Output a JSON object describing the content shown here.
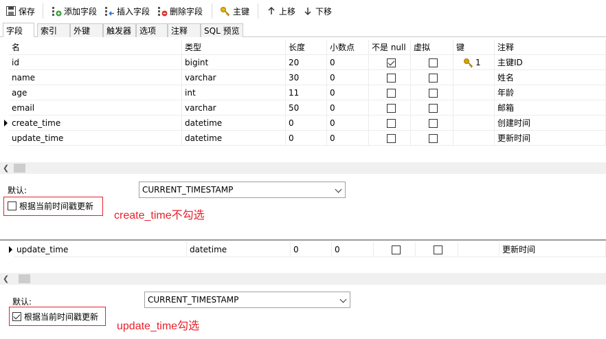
{
  "toolbar": {
    "save": "保存",
    "add_field": "添加字段",
    "insert_field": "插入字段",
    "delete_field": "删除字段",
    "primary_key": "主键",
    "move_up": "上移",
    "move_down": "下移"
  },
  "tabs": [
    "字段",
    "索引",
    "外键",
    "触发器",
    "选项",
    "注释",
    "SQL 预览"
  ],
  "columns": [
    "名",
    "类型",
    "长度",
    "小数点",
    "不是 null",
    "虚拟",
    "键",
    "注释"
  ],
  "rows": [
    {
      "name": "id",
      "type": "bigint",
      "length": "20",
      "decimal": "0",
      "not_null": true,
      "virtual": false,
      "key": "1",
      "comment": "主键ID"
    },
    {
      "name": "name",
      "type": "varchar",
      "length": "30",
      "decimal": "0",
      "not_null": false,
      "virtual": false,
      "key": "",
      "comment": "姓名"
    },
    {
      "name": "age",
      "type": "int",
      "length": "11",
      "decimal": "0",
      "not_null": false,
      "virtual": false,
      "key": "",
      "comment": "年龄"
    },
    {
      "name": "email",
      "type": "varchar",
      "length": "50",
      "decimal": "0",
      "not_null": false,
      "virtual": false,
      "key": "",
      "comment": "邮箱"
    },
    {
      "name": "create_time",
      "type": "datetime",
      "length": "0",
      "decimal": "0",
      "not_null": false,
      "virtual": false,
      "key": "",
      "comment": "创建时间"
    },
    {
      "name": "update_time",
      "type": "datetime",
      "length": "0",
      "decimal": "0",
      "not_null": false,
      "virtual": false,
      "key": "",
      "comment": "更新时间"
    }
  ],
  "panel1": {
    "default_label": "默认:",
    "default_value": "CURRENT_TIMESTAMP",
    "on_update_label": "根据当前时间戳更新",
    "on_update_checked": false,
    "annotation": "create_time不勾选"
  },
  "second_row": {
    "name": "update_time",
    "type": "datetime",
    "length": "0",
    "decimal": "0",
    "not_null": false,
    "virtual": false,
    "comment": "更新时间"
  },
  "panel2": {
    "default_label": "默认:",
    "default_value": "CURRENT_TIMESTAMP",
    "on_update_label": "根据当前时间戳更新",
    "on_update_checked": true,
    "annotation": "update_time勾选"
  },
  "colors": {
    "accent_red": "#e8202a",
    "key_gold": "#d9a300"
  }
}
